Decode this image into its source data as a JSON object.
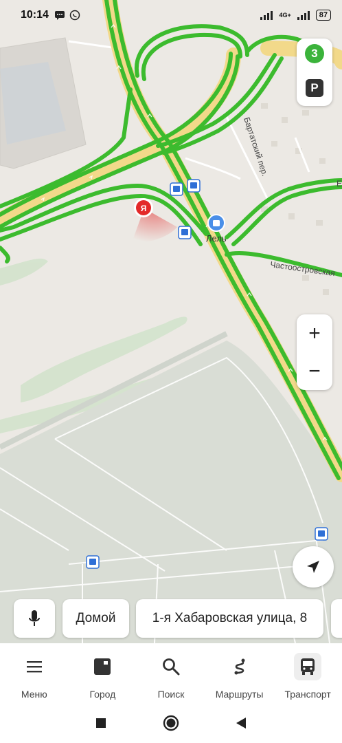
{
  "status_bar": {
    "time": "10:14",
    "network": "4G+",
    "battery": "87"
  },
  "map": {
    "labels": {
      "street_bartatsky": "Бартатский пер.",
      "street_chastoostrovskaya": "Частоостровская",
      "poi_lel": "Лель",
      "edge_fragment": "Е"
    },
    "user_marker_letter": "Я",
    "traffic_level": "3",
    "parking_label": "P",
    "colors": {
      "traffic_free": "#3cbb2e",
      "highway": "#f2d98a",
      "ground": "#ece9e4",
      "field": "#d6dbd2",
      "user_marker": "#e32929",
      "poi_marker": "#4a8fe8"
    }
  },
  "controls": {
    "zoom_in": "+",
    "zoom_out": "−",
    "locate_icon": "navigation-arrow-icon"
  },
  "chips": {
    "home": "Домой",
    "address": "1-я Хабаровская улица, 8"
  },
  "bottom_nav": [
    {
      "label": "Меню",
      "icon": "menu-icon"
    },
    {
      "label": "Город",
      "icon": "city-icon"
    },
    {
      "label": "Поиск",
      "icon": "search-icon"
    },
    {
      "label": "Маршруты",
      "icon": "routes-icon"
    },
    {
      "label": "Транспорт",
      "icon": "bus-icon"
    }
  ]
}
